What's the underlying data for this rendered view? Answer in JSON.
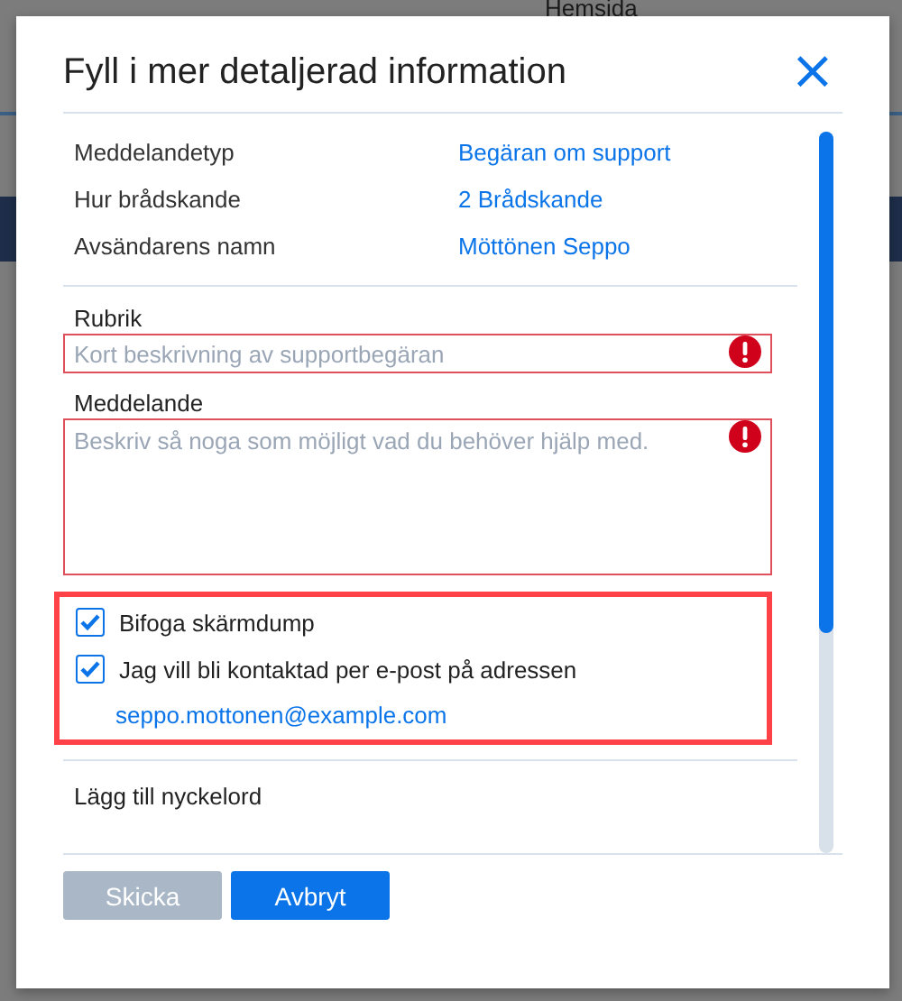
{
  "background": {
    "tab_label": "Hemsida"
  },
  "dialog": {
    "title": "Fyll i mer detaljerad information",
    "close_icon": "×",
    "info": [
      {
        "label": "Meddelandetyp",
        "value": "Begäran om support"
      },
      {
        "label": "Hur brådskande",
        "value": "2 Brådskande"
      },
      {
        "label": "Avsändarens namn",
        "value": "Möttönen Seppo"
      }
    ],
    "fields": [
      {
        "kind": "input",
        "label": "Rubrik",
        "placeholder": "Kort beskrivning av supportbegäran",
        "error": true
      },
      {
        "kind": "textarea",
        "label": "Meddelande",
        "placeholder": "Beskriv så noga som möjligt vad du behöver hjälp med.",
        "error": true
      }
    ],
    "options": {
      "highlighted": true,
      "checkboxes": [
        {
          "label": "Bifoga skärmdump",
          "checked": true
        },
        {
          "label": "Jag vill bli kontaktad per e-post på adressen",
          "checked": true
        }
      ],
      "email": "seppo.mottonen@example.com"
    },
    "keywords_link": "Lägg till nyckelord",
    "buttons": [
      {
        "label": "Skicka",
        "disabled": true
      },
      {
        "label": "Avbryt",
        "disabled": false
      }
    ]
  }
}
